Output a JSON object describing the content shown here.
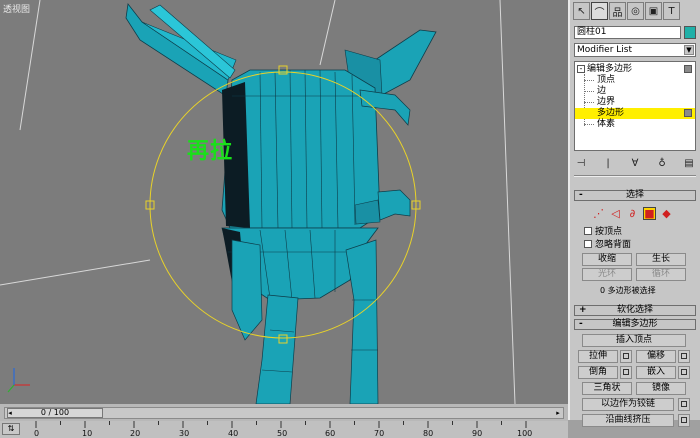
{
  "viewport": {
    "label": "透视图",
    "annotation": "再拉"
  },
  "panel": {
    "tabs": [
      {
        "icon": "create-pointer-icon",
        "glyph": "↖"
      },
      {
        "icon": "modify-icon",
        "glyph": "⌒"
      },
      {
        "icon": "hierarchy-icon",
        "glyph": "品"
      },
      {
        "icon": "motion-icon",
        "glyph": "◎"
      },
      {
        "icon": "display-icon",
        "glyph": "▣"
      },
      {
        "icon": "utilities-icon",
        "glyph": "T"
      }
    ],
    "object_name": "圆柱01",
    "object_color": "#1fb0a8",
    "modifier_list": "Modifier List",
    "stack": {
      "root": "编辑多边形",
      "items": [
        "顶点",
        "边",
        "边界",
        "多边形",
        "体素"
      ],
      "selected_index": 3
    },
    "selection": {
      "title": "选择",
      "check_vertex": "按顶点",
      "check_backface": "忽略背面",
      "shrink": "收缩",
      "grow": "生长",
      "ring": "光环",
      "loop": "循环",
      "status": "0 多边形被选择"
    },
    "soft_selection": {
      "title": "软化选择"
    },
    "edit_polygons": {
      "title": "编辑多边形",
      "insert_vertex": "插入顶点",
      "extrude": "拉伸",
      "outline": "偏移",
      "bevel": "倒角",
      "inset": "嵌入",
      "flip": "三角状",
      "mirror": "镜像",
      "hinge": "以边作为铰链",
      "extrude_spline": "沿曲线挤压"
    }
  },
  "timeline": {
    "frame_display": "0 / 100",
    "ticks": [
      "0",
      "10",
      "20",
      "30",
      "40",
      "50",
      "60",
      "70",
      "80",
      "90",
      "100"
    ]
  },
  "colors": {
    "viewport_bg": "#7c7c7c",
    "mesh": "#1aa3b6",
    "gizmo": "#e8d22a",
    "annotation": "#19e019",
    "stack_selected": "#ffef00"
  }
}
